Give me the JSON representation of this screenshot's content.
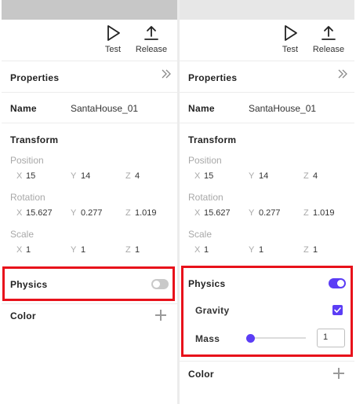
{
  "toolbar": {
    "test_label": "Test",
    "release_label": "Release"
  },
  "properties": {
    "title": "Properties",
    "name_label": "Name",
    "name_value": "SantaHouse_01",
    "transform_title": "Transform",
    "position": {
      "label": "Position",
      "x": "15",
      "y": "14",
      "z": "4"
    },
    "rotation": {
      "label": "Rotation",
      "x": "15.627",
      "y": "0.277",
      "z": "1.019"
    },
    "scale": {
      "label": "Scale",
      "x": "1",
      "y": "1",
      "z": "1"
    },
    "axis_labels": {
      "x": "X",
      "y": "Y",
      "z": "Z"
    }
  },
  "physics": {
    "title": "Physics",
    "left_state": "off",
    "right_state": "on",
    "gravity_label": "Gravity",
    "gravity_checked": true,
    "mass_label": "Mass",
    "mass_value": "1",
    "mass_slider_fraction": 0
  },
  "color": {
    "title": "Color"
  },
  "icons": [
    "play-icon",
    "upload-icon",
    "double-chevron-right-icon",
    "plus-icon",
    "check-icon"
  ],
  "colors": {
    "accent": "#5b3df5",
    "highlight": "#e8121b"
  }
}
